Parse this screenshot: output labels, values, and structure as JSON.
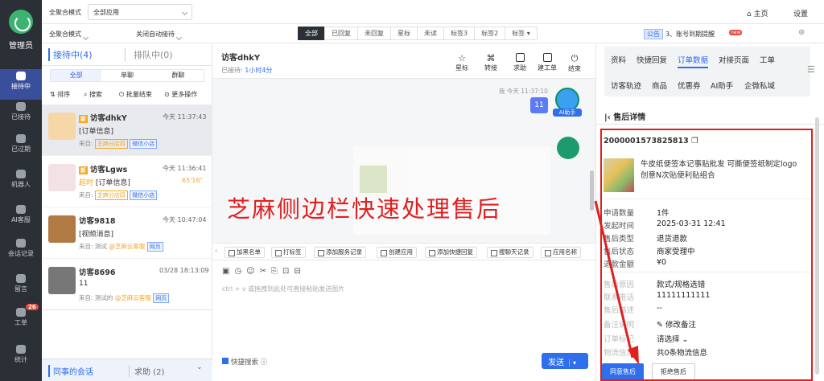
{
  "nav": {
    "role": "管理员",
    "items": [
      "接待中",
      "已接待",
      "已过期",
      "机器人",
      "AI客服",
      "会话记录",
      "留言",
      "工单",
      "统计"
    ],
    "work_order_badge": "26"
  },
  "top1": {
    "mode_label": "全聚合模式",
    "app_select": "全部应用",
    "home": "主页",
    "settings": "设置"
  },
  "top2": {
    "mode": "全聚合模式",
    "auto": "关闭自动接待",
    "tabs": [
      "全部",
      "已回复",
      "未回复",
      "星标",
      "未读",
      "标签3",
      "标签2",
      "标签"
    ],
    "notice_tag": "公告",
    "notice_text": "3、账号到期提醒",
    "notice_new": "new"
  },
  "left": {
    "tab_active": "接待中(4)",
    "tab_queue": "排队中(0)",
    "subtabs": [
      "全部",
      "单聊",
      "群聊"
    ],
    "actions": [
      "排序",
      "搜索",
      "批量结束",
      "更多操作"
    ],
    "convs": [
      {
        "name": "访客dhkY",
        "time": "今天 11:37:43",
        "msg": "[订单信息]",
        "from": "来自:",
        "shop": "芝麻分店四",
        "src": "微信小店",
        "new": "新"
      },
      {
        "name": "访客Lgws",
        "time": "今天 11:36:41",
        "msg": "[订单信息]",
        "from": "来自:",
        "shop": "芝麻分店四",
        "src": "微信小店",
        "new": "新",
        "overtime": "超时",
        "dur": "65'16\""
      },
      {
        "name": "访客9818",
        "time": "今天 10:47:04",
        "msg": "[视频消息]",
        "from": "来自: 测试",
        "shop": "@芝麻云客服",
        "src": "网页"
      },
      {
        "name": "访客8696",
        "time": "03/28 18:13:09",
        "msg": "11",
        "from": "来自: 测试的",
        "shop": "@芝麻云客服",
        "src": "网页"
      }
    ],
    "footer_colleague": "同事的会话",
    "footer_help": "求助 (2)"
  },
  "chat": {
    "title": "访客dhkY",
    "received": "已接待:",
    "duration": "1小时4分",
    "tools": [
      "星标",
      "转接",
      "求助",
      "建工单",
      "结束"
    ],
    "msg_meta": "我 今天 11:37:10",
    "msg_text": "11",
    "ai_label": "AI助手",
    "toolbar": [
      "加黑名单",
      "打标签",
      "添加服务记录",
      "创建应用",
      "添加快捷回复",
      "搜聊天记录",
      "应用名称"
    ],
    "placeholder": "ctrl + v 或拖拽到此处可直接粘贴发送图片",
    "search_check": "快捷搜索",
    "send": "发送"
  },
  "right": {
    "tabs_row1": [
      "资料",
      "快捷回复",
      "订单数据",
      "对接页面",
      "工单"
    ],
    "tabs_row2": [
      "访客轨迹",
      "商品",
      "优惠券",
      "AI助手",
      "企微私域"
    ],
    "section": "售后详情",
    "order_no": "2000001573825813",
    "product": "牛皮纸便签本记事贴批发 可撕便签纸制定logo创意N次贴便利贴组合",
    "fields1": [
      [
        "申请数量",
        "1件"
      ],
      [
        "发起时间",
        "2025-03-31 12:41"
      ],
      [
        "售后类型",
        "退货退款"
      ],
      [
        "售后状态",
        "商家受理中"
      ],
      [
        "退款金额",
        "¥0"
      ]
    ],
    "fields2": [
      [
        "售后原因",
        "款式/规格选错"
      ],
      [
        "联系电话",
        "11111111111"
      ],
      [
        "售后描述",
        "--"
      ],
      [
        "备注说明",
        "修改备注"
      ],
      [
        "订单标记",
        "请选择"
      ],
      [
        "物流信息",
        "共0条物流信息"
      ]
    ],
    "agree": "同意售后",
    "reject": "拒绝售后"
  },
  "overlay": "芝麻侧边栏快速处理售后",
  "colors": {
    "accent": "#2f6fed",
    "red": "#e02020",
    "nav": "#2b2f36"
  }
}
